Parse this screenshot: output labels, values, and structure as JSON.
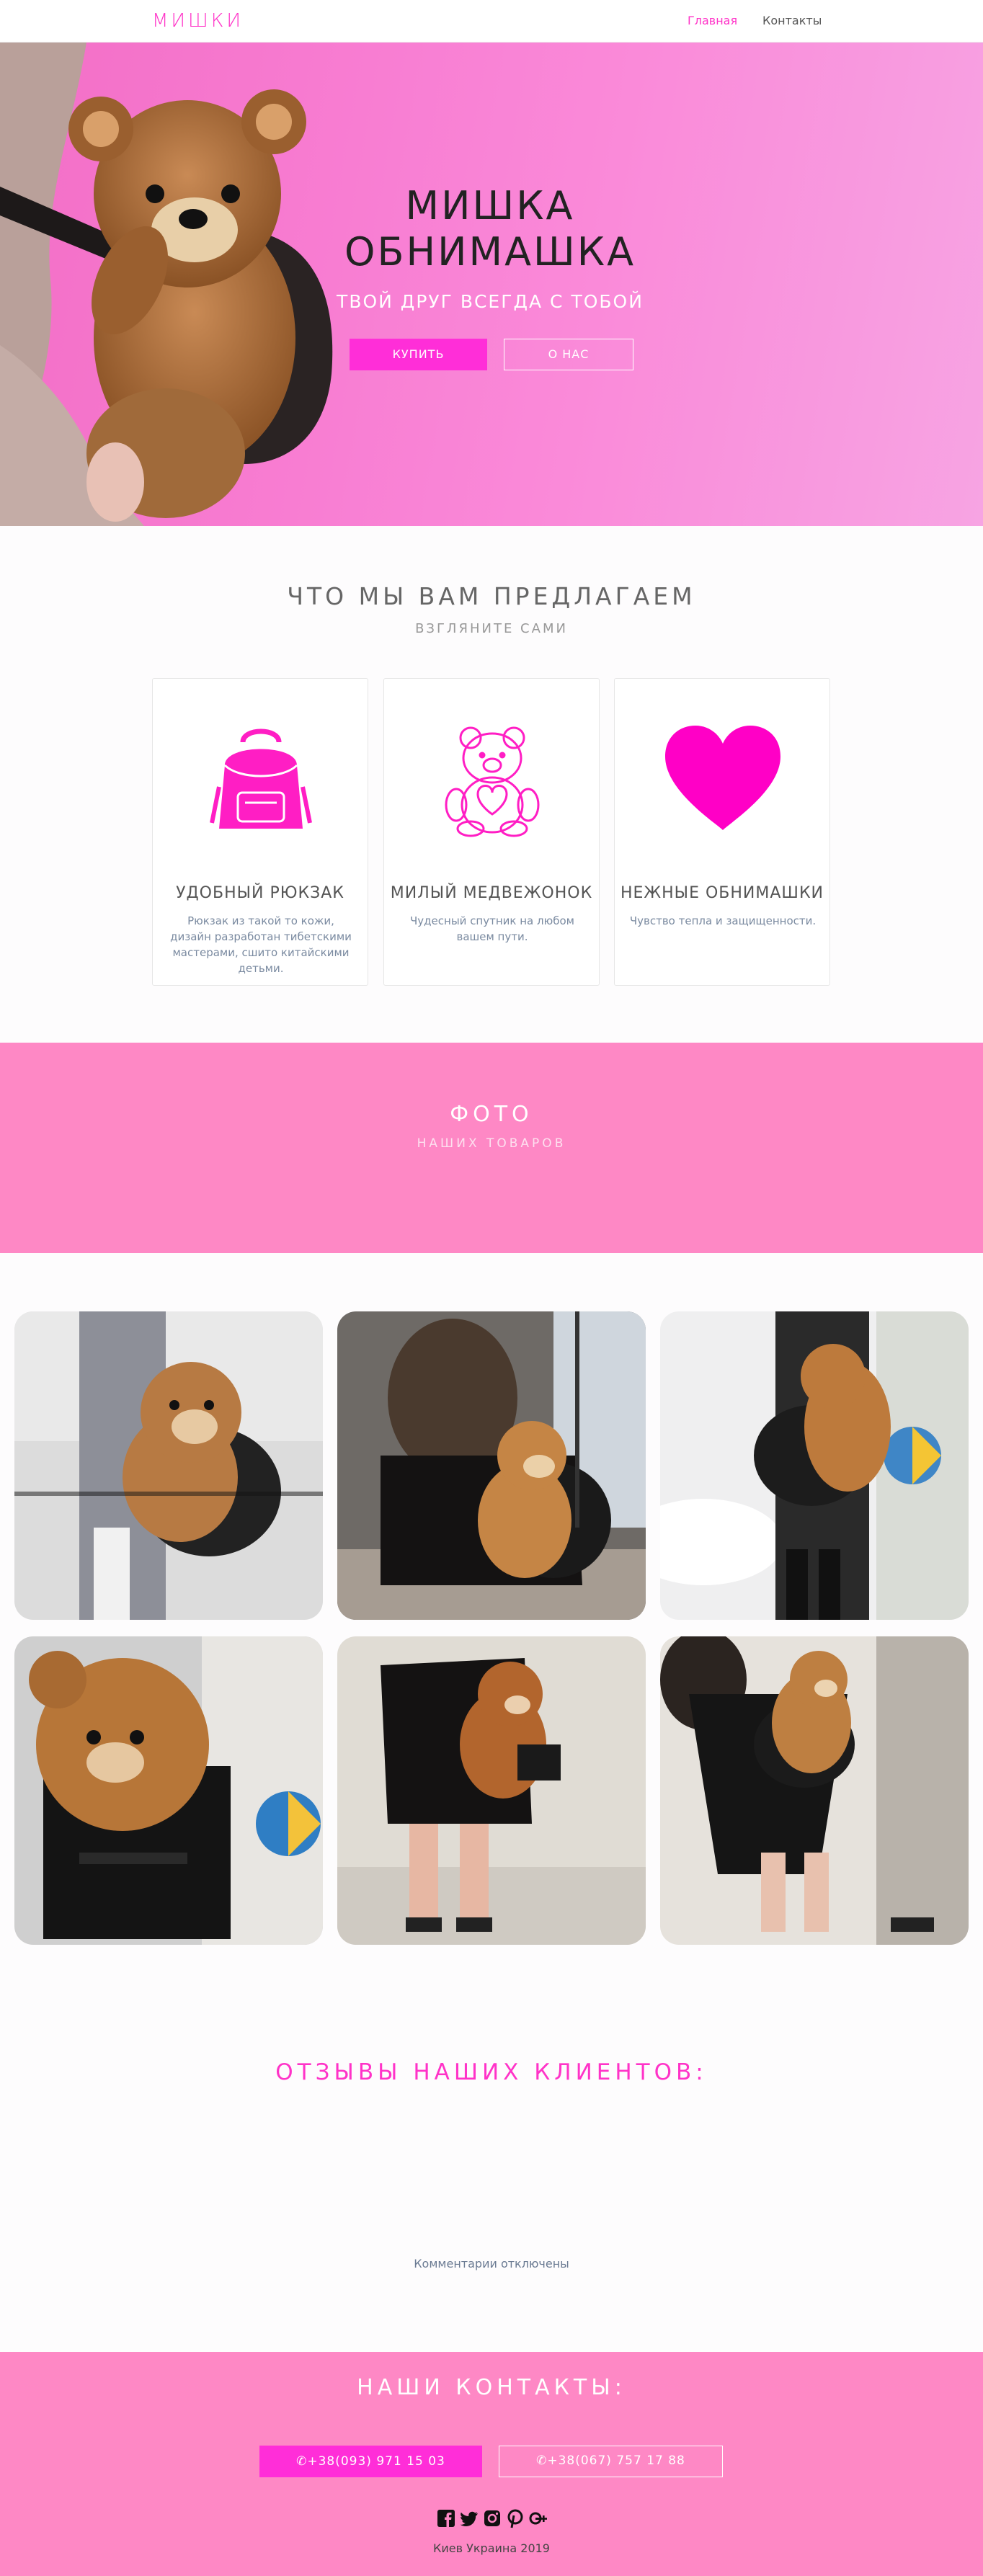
{
  "nav": {
    "brand": "МИШКИ",
    "links": [
      "Главная",
      "Контакты"
    ]
  },
  "hero": {
    "title_line1": "МИШКА",
    "title_line2": "ОБНИМАШКА",
    "subtitle": "ТВОЙ ДРУГ ВСЕГДА С ТОБОЙ",
    "buy_label": "КУПИТЬ",
    "about_label": "О НАС"
  },
  "offer": {
    "title": "ЧТО МЫ ВАМ ПРЕДЛАГАЕМ",
    "subtitle": "ВЗГЛЯНИТЕ САМИ",
    "cards": [
      {
        "icon": "backpack-icon",
        "title": "УДОБНЫЙ РЮКЗАК",
        "text": "Рюкзак из такой то кожи, дизайн разработан тибетскими мастерами, сшито китайскими детьми."
      },
      {
        "icon": "teddy-bear-icon",
        "title": "МИЛЫЙ МЕДВЕЖОНОК",
        "text": "Чудесный спутник на любом вашем пути."
      },
      {
        "icon": "heart-icon",
        "title": "НЕЖНЫЕ ОБНИМАШКИ",
        "text": "Чувство тепла и защищенности."
      }
    ]
  },
  "photos": {
    "title": "ФОТО",
    "subtitle": "НАШИХ ТОВАРОВ"
  },
  "reviews": {
    "title": "ОТЗЫВЫ НАШИХ КЛИЕНТОВ:",
    "comments_status": "Комментарии отключены"
  },
  "footer": {
    "title": "НАШИ КОНТАКТЫ:",
    "phone1": "✆+38(093) 971 15 03",
    "phone2": "✆+38(067) 757 17 88",
    "socials": [
      "facebook-icon",
      "twitter-icon",
      "instagram-icon",
      "pinterest-icon",
      "google-plus-icon"
    ],
    "copyright": "Киев Украина 2019"
  },
  "colors": {
    "accent": "#ff33c8",
    "button": "#ff2ed8",
    "band": "#fe88c5"
  }
}
